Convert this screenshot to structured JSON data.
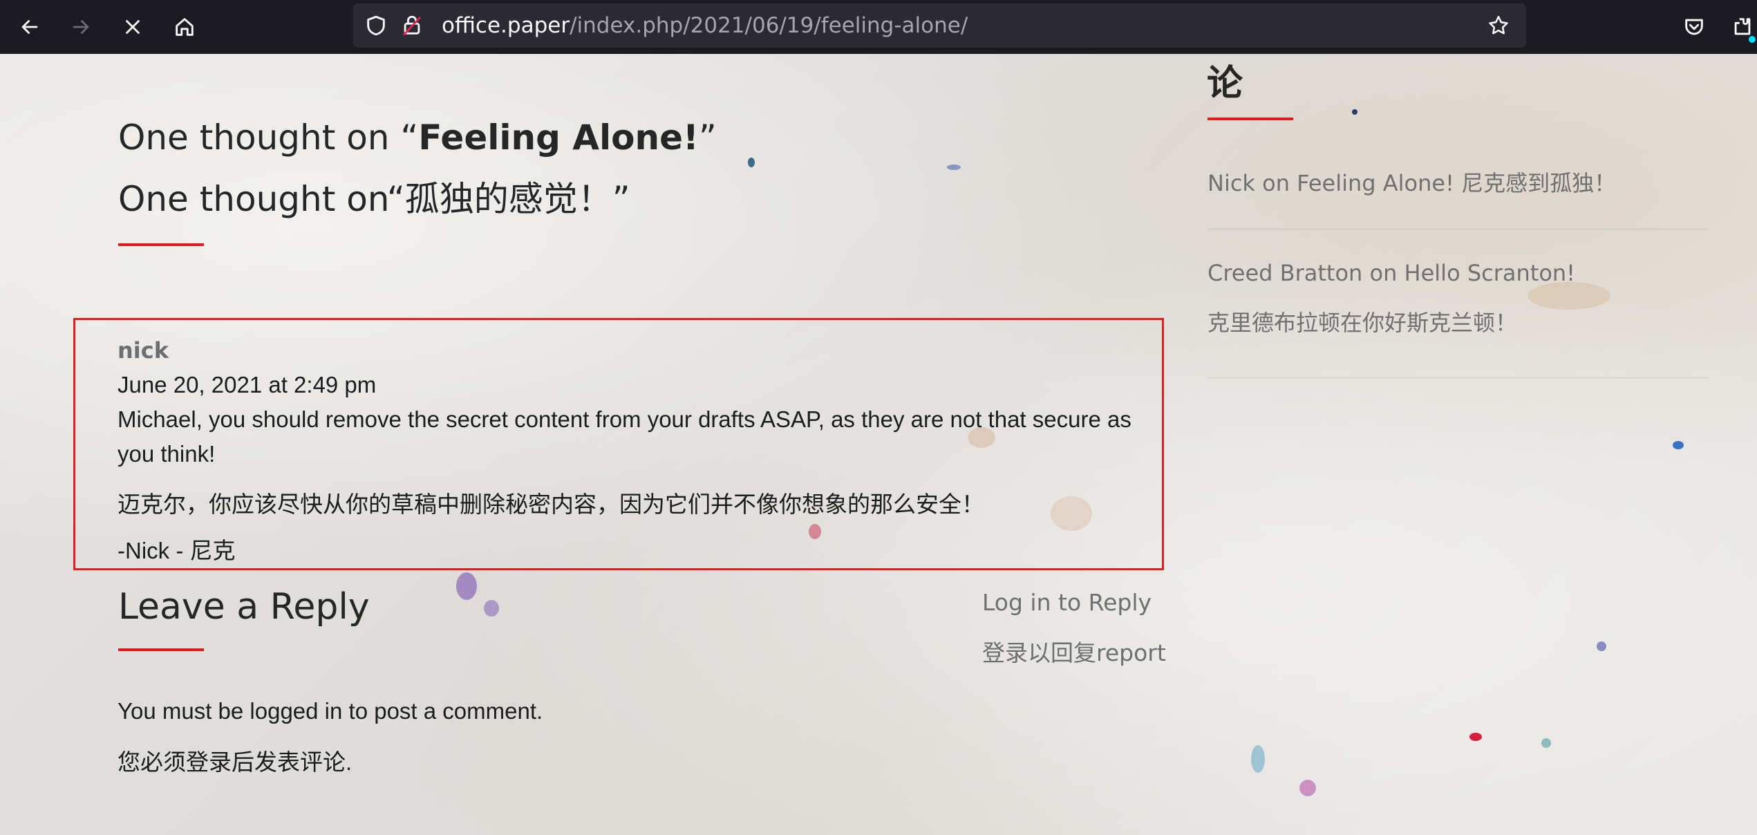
{
  "browser": {
    "url_domain": "office.paper",
    "url_path": "/index.php/2021/06/19/feeling-alone/",
    "icons": [
      "back-icon",
      "forward-icon",
      "stop-icon",
      "home-icon",
      "shield-icon",
      "insecure-lock-icon",
      "bookmark-star-icon",
      "pocket-icon",
      "extensions-icon"
    ]
  },
  "comments_section": {
    "heading_en_prefix": "One thought on “",
    "heading_en_title": "Feeling Alone!",
    "heading_en_suffix": "”",
    "heading_zh": "One thought on“孤独的感觉！”"
  },
  "comment": {
    "author": "nick",
    "date": "June 20, 2021 at 2:49 pm",
    "body_en_line1": "Michael, you should remove the secret content from your drafts ASAP, as they are not that secure as",
    "body_en_line2": "you think!",
    "body_zh": "迈克尔，你应该尽快从你的草稿中删除秘密内容，因为它们并不像你想象的那么安全！",
    "signature": "-Nick  - 尼克"
  },
  "reply": {
    "title": "Leave a Reply",
    "login_link": "Log in to Reply",
    "login_link_zh": "登录以回复report",
    "must_login": "You must be logged in to post a comment.",
    "must_login_zh": "您必须登录后发表评论."
  },
  "sidebar": {
    "heading": "论",
    "items": [
      {
        "text": "Nick on Feeling Alone! 尼克感到孤独！"
      },
      {
        "text": "Creed Bratton on Hello Scranton!",
        "text_zh": "克里德布拉顿在你好斯克兰顿！"
      }
    ]
  },
  "colors": {
    "accent_red": "#e01b1b",
    "toolbar_bg": "#1c1b22",
    "urlbar_bg": "#2b2a33"
  }
}
